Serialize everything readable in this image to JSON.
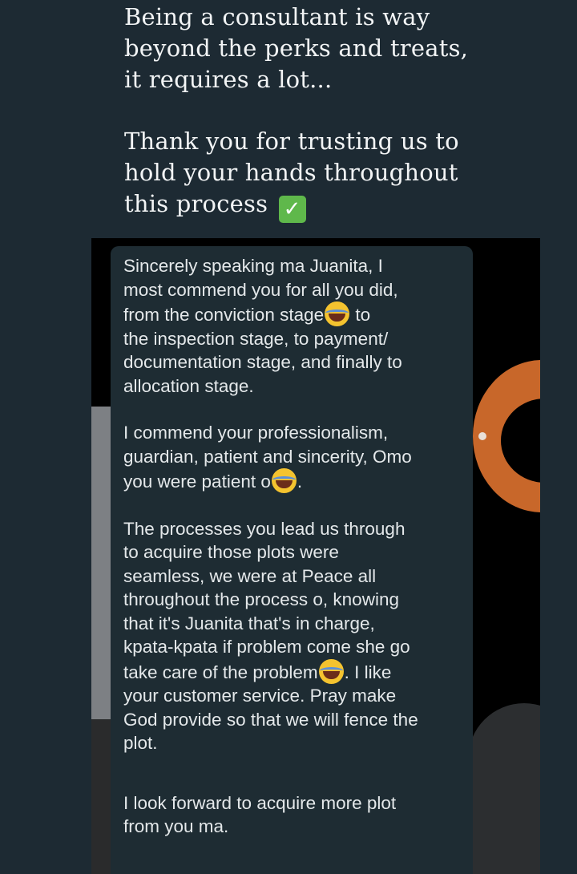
{
  "caption": {
    "line1": "Being a consultant is way",
    "line2": "beyond the perks and treats,",
    "line3": "it requires a lot...",
    "line4": "Thank you for trusting us to",
    "line5": "hold your hands throughout",
    "line6": "this process",
    "emoji": "✓"
  },
  "message": {
    "p1": {
      "l1": "Sincerely speaking ma Juanita, I",
      "l2": "most commend you for all you did,",
      "l3a": "from the conviction stage",
      "l3b": " to",
      "l4": "the inspection stage, to payment/",
      "l5": "documentation stage, and finally to",
      "l6": "allocation stage."
    },
    "p2": {
      "l1": "I commend your professionalism,",
      "l2": "guardian, patient and  sincerity, Omo",
      "l3a": "you were patient o",
      "l3b": "."
    },
    "p3": {
      "l1": "The processes you lead us through",
      "l2": "to acquire those plots were",
      "l3": "seamless, we were at Peace all",
      "l4": "throughout the process o, knowing",
      "l5": "that  it's Juanita that's in charge,",
      "l6": "kpata-kpata if problem come she go",
      "l7a": "take care of the problem",
      "l7b": ". I like",
      "l8": "your customer service. Pray make",
      "l9": "God provide so that we will fence the",
      "l10": "plot."
    },
    "p4": {
      "l1": "I look forward to acquire more plot",
      "l2": "from you ma."
    },
    "emoji_name": "face-with-tears-of-joy-icon"
  },
  "colors": {
    "page_bg": "#1d2a33",
    "bubble_bg": "#1e2c33",
    "accent_orange": "#c8672a",
    "check_green": "#5fb84b"
  }
}
